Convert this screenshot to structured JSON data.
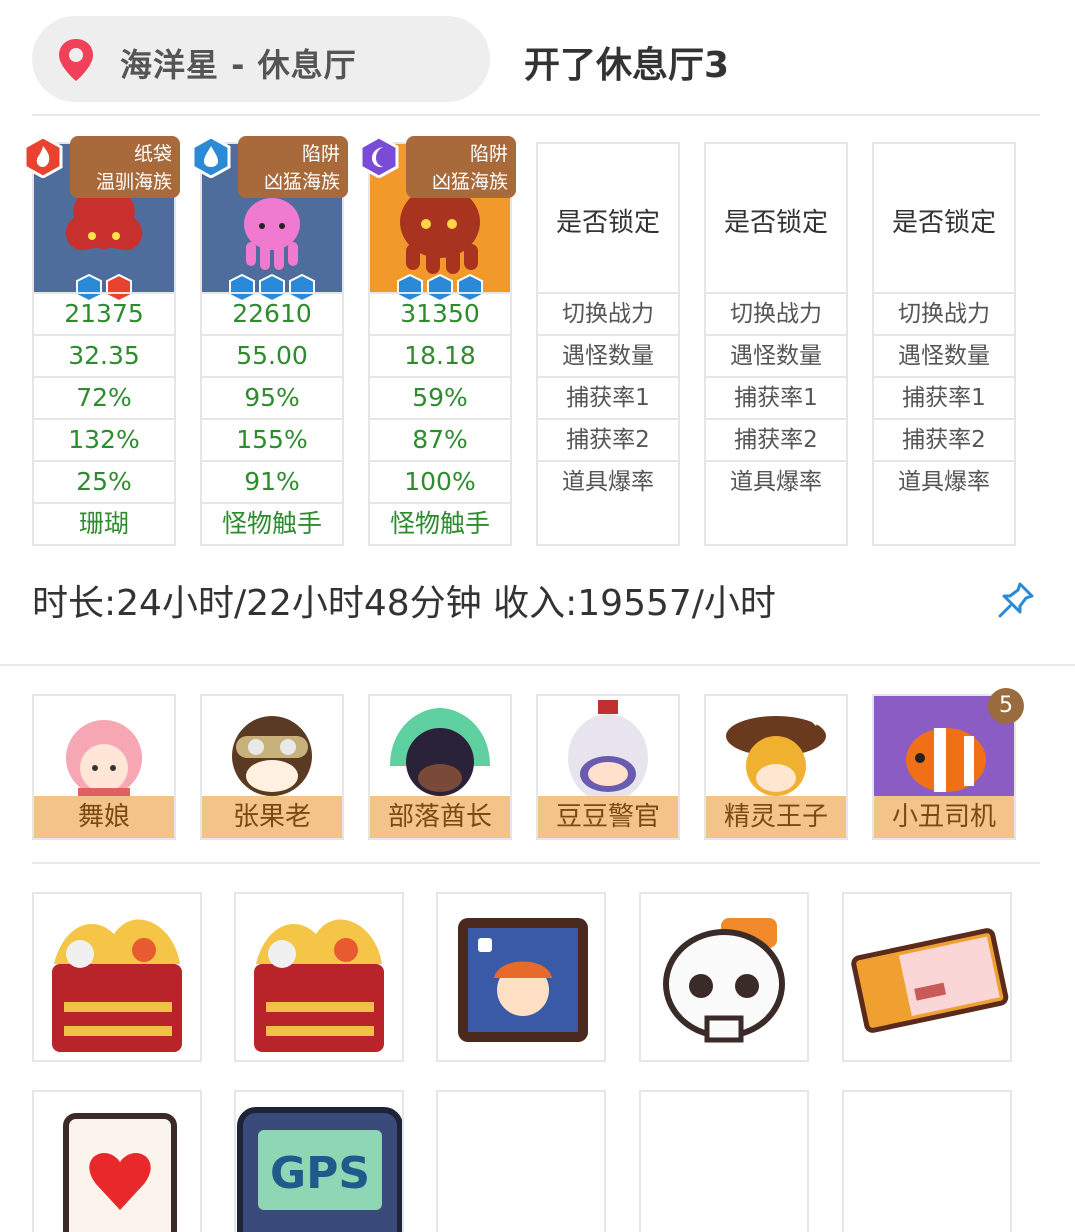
{
  "header": {
    "location": "海洋星 - 休息厅",
    "title": "开了休息厅3"
  },
  "monsters": [
    {
      "tag_top": "纸袋",
      "tag_bottom": "温驯海族",
      "element": "fire",
      "stats": [
        "21375",
        "32.35",
        "72%",
        "132%",
        "25%",
        "珊瑚"
      ]
    },
    {
      "tag_top": "陷阱",
      "tag_bottom": "凶猛海族",
      "element": "water",
      "stats": [
        "22610",
        "55.00",
        "95%",
        "155%",
        "91%",
        "怪物触手"
      ]
    },
    {
      "tag_top": "陷阱",
      "tag_bottom": "凶猛海族",
      "element": "dark",
      "stats": [
        "31350",
        "18.18",
        "59%",
        "87%",
        "100%",
        "怪物触手"
      ]
    }
  ],
  "empty_slots": [
    {
      "lock": "是否锁定",
      "rows": [
        "切换战力",
        "遇怪数量",
        "捕获率1",
        "捕获率2",
        "道具爆率"
      ]
    },
    {
      "lock": "是否锁定",
      "rows": [
        "切换战力",
        "遇怪数量",
        "捕获率1",
        "捕获率2",
        "道具爆率"
      ]
    },
    {
      "lock": "是否锁定",
      "rows": [
        "切换战力",
        "遇怪数量",
        "捕获率1",
        "捕获率2",
        "道具爆率"
      ]
    }
  ],
  "summary": "时长:24小时/22小时48分钟 收入:19557/小时",
  "characters": [
    {
      "name": "舞娘",
      "icon": "dancer-avatar"
    },
    {
      "name": "张果老",
      "icon": "goggles-avatar"
    },
    {
      "name": "部落酋长",
      "icon": "chief-avatar"
    },
    {
      "name": "豆豆警官",
      "icon": "officer-avatar"
    },
    {
      "name": "精灵王子",
      "icon": "prince-avatar"
    },
    {
      "name": "小丑司机",
      "icon": "clownfish-avatar",
      "badge": "5"
    }
  ],
  "items": [
    {
      "icon": "bento-box-icon"
    },
    {
      "icon": "bento-box-icon"
    },
    {
      "icon": "photo-frame-icon"
    },
    {
      "icon": "skull-icon"
    },
    {
      "icon": "ticket-icon"
    },
    {
      "icon": "ace-of-hearts-icon"
    },
    {
      "icon": "gps-device-icon"
    },
    {
      "icon": ""
    },
    {
      "icon": ""
    },
    {
      "icon": ""
    }
  ]
}
